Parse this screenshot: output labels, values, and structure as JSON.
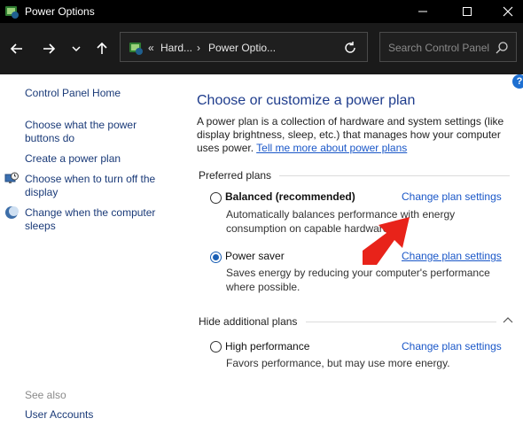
{
  "window": {
    "title": "Power Options"
  },
  "nav": {
    "crumbs": [
      "«",
      "Hard...",
      "›",
      "Power Optio..."
    ],
    "search_placeholder": "Search Control Panel"
  },
  "sidebar": {
    "items": [
      {
        "label": "Control Panel Home"
      },
      {
        "label": "Choose what the power buttons do"
      },
      {
        "label": "Create a power plan"
      },
      {
        "label": "Choose when to turn off the display",
        "icon": "display-clock-icon"
      },
      {
        "label": "Change when the computer sleeps",
        "icon": "moon-sleep-icon"
      }
    ],
    "see_also_label": "See also",
    "see_also_items": [
      {
        "label": "User Accounts"
      }
    ]
  },
  "main": {
    "heading": "Choose or customize a power plan",
    "description": "A power plan is a collection of hardware and system settings (like display brightness, sleep, etc.) that manages how your computer uses power.",
    "description_link": "Tell me more about power plans",
    "preferred_label": "Preferred plans",
    "hide_label": "Hide additional plans",
    "plans": [
      {
        "name": "Balanced (recommended)",
        "description": "Automatically balances performance with energy consumption on capable hardware.",
        "change_label": "Change plan settings",
        "selected": false
      },
      {
        "name": "Power saver",
        "description": "Saves energy by reducing your computer's performance where possible.",
        "change_label": "Change plan settings",
        "selected": true
      },
      {
        "name": "High performance",
        "description": "Favors performance, but may use more energy.",
        "change_label": "Change plan settings",
        "selected": false
      }
    ]
  },
  "help_label": "?",
  "colors": {
    "accent": "#1a5fb4",
    "link": "#1a57c8",
    "heading": "#1e3c8c",
    "annotation_arrow": "#e8231a"
  }
}
